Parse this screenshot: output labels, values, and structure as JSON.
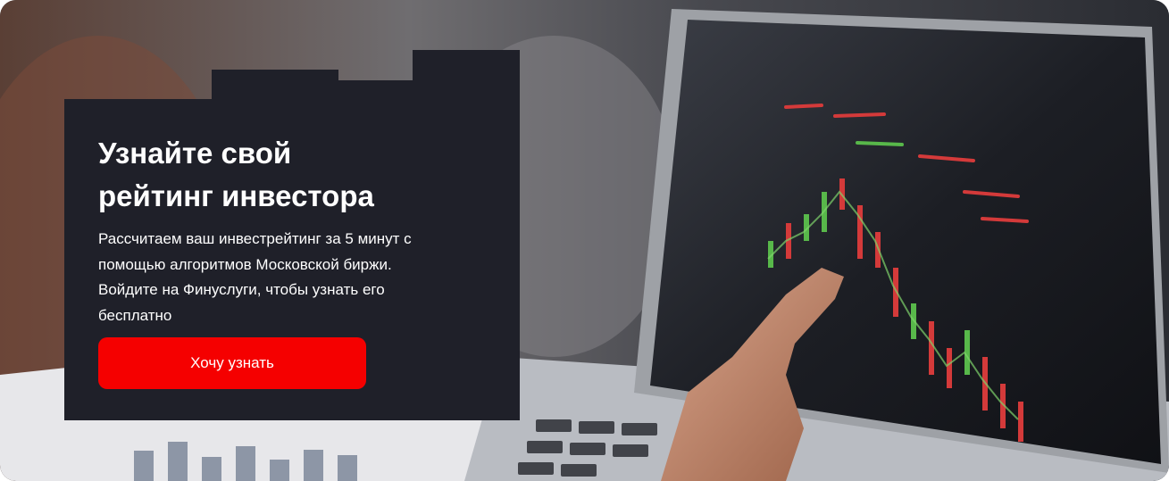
{
  "banner": {
    "title_lines": [
      "Узнайте свой",
      "рейтинг инвестора"
    ],
    "description_lines": [
      "Рассчитаем ваш инвестрейтинг за 5 минут с",
      "помощью алгоритмов Московской биржи.",
      "Войдите на Финуслуги, чтобы узнать его",
      "бесплатно"
    ],
    "cta_label": "Хочу узнать"
  },
  "colors": {
    "card_background": "#1f2029",
    "cta_background": "#f50000",
    "text": "#ffffff"
  },
  "background_image": "photo of a hand pointing at trading candlestick chart on a laptop screen"
}
